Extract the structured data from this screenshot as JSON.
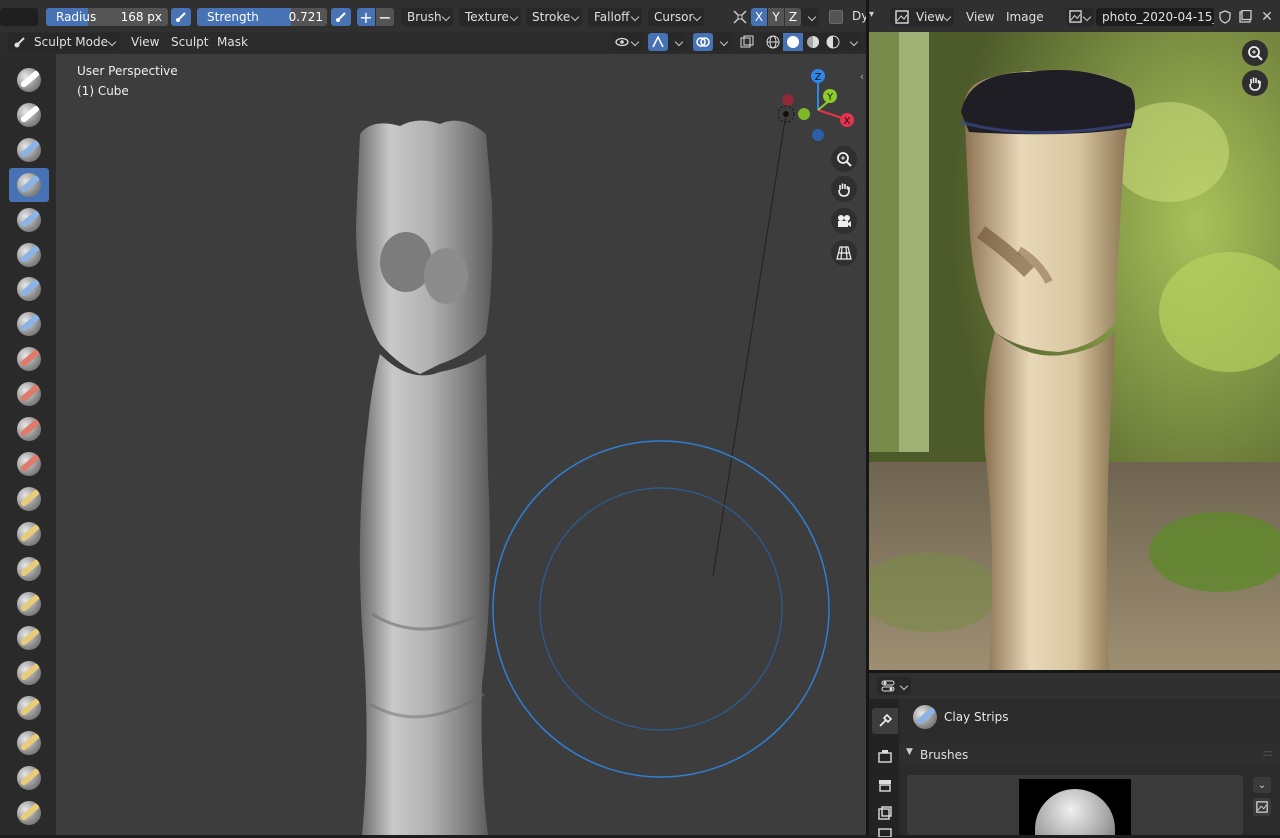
{
  "header": {
    "radius_label": "Radius",
    "radius_value": "168 px",
    "strength_label": "Strength",
    "strength_value": "0.721",
    "menus": [
      "Brush",
      "Texture",
      "Stroke",
      "Falloff",
      "Cursor"
    ],
    "axis_x": "X",
    "axis_y": "Y",
    "axis_z": "Z",
    "dyntopo": "Dy"
  },
  "viewport_header": {
    "mode": "Sculpt Mode",
    "menus": [
      "View",
      "Sculpt",
      "Mask"
    ]
  },
  "viewport": {
    "perspective": "User Perspective",
    "object": "(1) Cube"
  },
  "image_editor": {
    "view_label_1": "View",
    "view_label_2": "View",
    "image_label": "Image",
    "image_name": "photo_2020-04-15_..."
  },
  "properties": {
    "brush_name": "Clay Strips",
    "brushes_panel": "Brushes"
  },
  "tools": [
    {
      "name": "draw-tool",
      "stroke": "#ffffff",
      "active": false
    },
    {
      "name": "draw-sharp-tool",
      "stroke": "#ffffff",
      "active": false
    },
    {
      "name": "clay-tool",
      "stroke": "#8ab4e8",
      "active": false
    },
    {
      "name": "clay-strips-tool",
      "stroke": "#8ab4e8",
      "active": true
    },
    {
      "name": "clay-thumb-tool",
      "stroke": "#8ab4e8",
      "active": false
    },
    {
      "name": "layer-tool",
      "stroke": "#8ab4e8",
      "active": false
    },
    {
      "name": "inflate-tool",
      "stroke": "#8ab4e8",
      "active": false
    },
    {
      "name": "blob-tool",
      "stroke": "#8ab4e8",
      "active": false
    },
    {
      "name": "crease-tool",
      "stroke": "#e07a6a",
      "active": false
    },
    {
      "name": "smooth-tool",
      "stroke": "#e07a6a",
      "active": false
    },
    {
      "name": "flatten-tool",
      "stroke": "#e07a6a",
      "active": false
    },
    {
      "name": "fill-tool",
      "stroke": "#e07a6a",
      "active": false
    },
    {
      "name": "scrape-tool",
      "stroke": "#e8cc7a",
      "active": false
    },
    {
      "name": "multiplane-scrape-tool",
      "stroke": "#e8cc7a",
      "active": false
    },
    {
      "name": "pinch-tool",
      "stroke": "#e8cc7a",
      "active": false
    },
    {
      "name": "grab-tool",
      "stroke": "#e8cc7a",
      "active": false
    },
    {
      "name": "elastic-deform-tool",
      "stroke": "#e8cc7a",
      "active": false
    },
    {
      "name": "snake-hook-tool",
      "stroke": "#e8cc7a",
      "active": false
    },
    {
      "name": "thumb-tool",
      "stroke": "#e8cc7a",
      "active": false
    },
    {
      "name": "pose-tool",
      "stroke": "#e8cc7a",
      "active": false
    },
    {
      "name": "nudge-tool",
      "stroke": "#e8cc7a",
      "active": false
    },
    {
      "name": "rotate-tool",
      "stroke": "#e8cc7a",
      "active": false
    }
  ],
  "colors": {
    "accent": "#4772b3",
    "brush_circle": "#2f7fd3",
    "axis_x": "#e8334e",
    "axis_y": "#8fcc29",
    "axis_z": "#2f87e8"
  }
}
